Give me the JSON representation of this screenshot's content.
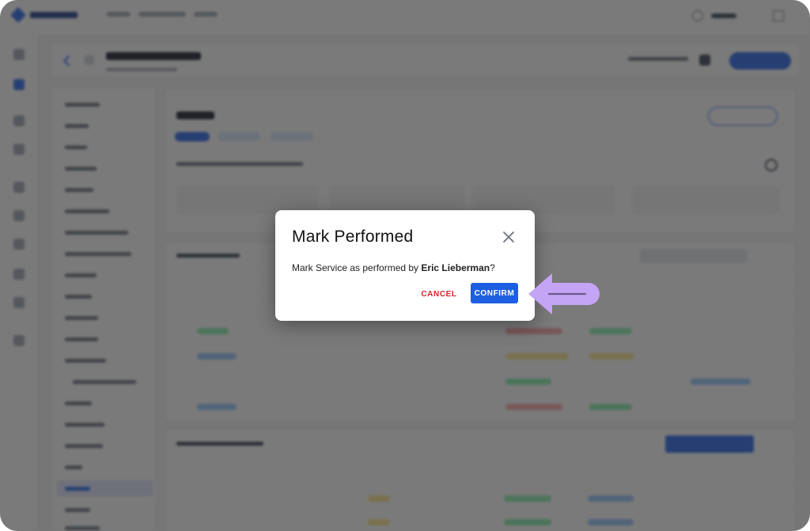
{
  "dialog": {
    "title": "Mark Performed",
    "message_prefix": "Mark Service as performed by ",
    "performer": "Eric Lieberman",
    "message_suffix": "?",
    "cancel_label": "CANCEL",
    "confirm_label": "CONFIRM"
  },
  "colors": {
    "confirm_bg": "#1d5fe0",
    "cancel_text": "#dc2626",
    "hint_arrow": "#c4a4f5",
    "overlay": "rgba(40,40,40,0.62)"
  },
  "icons": {
    "close": "close-icon",
    "hint": "arrow-left-icon"
  }
}
